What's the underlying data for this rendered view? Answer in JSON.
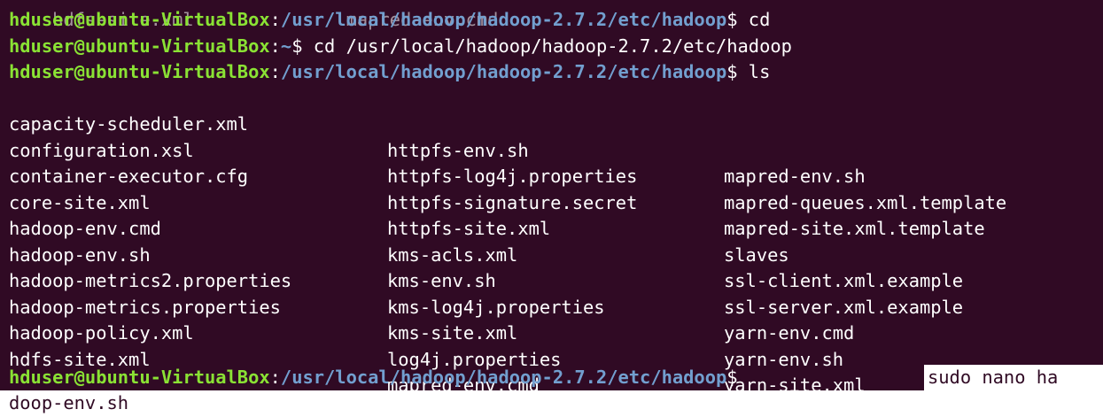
{
  "terminal": {
    "colors": {
      "background": "#300a24",
      "user": "#8ae234",
      "path": "#729fcf",
      "text": "#ffffff"
    },
    "partial_top_line": "hdfs-site.xml              mapred-env.cmd",
    "prompts": [
      {
        "user": "hduser@ubuntu-VirtualBox",
        "sep": ":",
        "path": "/usr/local/hadoop/hadoop-2.7.2/etc/hadoop",
        "end": "$",
        "command": " cd"
      },
      {
        "user": "hduser@ubuntu-VirtualBox",
        "sep": ":",
        "path": "~",
        "end": "$",
        "command": " cd /usr/local/hadoop/hadoop-2.7.2/etc/hadoop"
      },
      {
        "user": "hduser@ubuntu-VirtualBox",
        "sep": ":",
        "path": "/usr/local/hadoop/hadoop-2.7.2/etc/hadoop",
        "end": "$",
        "command": " ls"
      }
    ],
    "listing": [
      [
        "capacity-scheduler.xml",
        "httpfs-env.sh",
        "mapred-env.sh"
      ],
      [
        "configuration.xsl",
        "httpfs-log4j.properties",
        "mapred-queues.xml.template"
      ],
      [
        "container-executor.cfg",
        "httpfs-signature.secret",
        "mapred-site.xml.template"
      ],
      [
        "core-site.xml",
        "httpfs-site.xml",
        "slaves"
      ],
      [
        "hadoop-env.cmd",
        "kms-acls.xml",
        "ssl-client.xml.example"
      ],
      [
        "hadoop-env.sh",
        "kms-env.sh",
        "ssl-server.xml.example"
      ],
      [
        "hadoop-metrics2.properties",
        "kms-log4j.properties",
        "yarn-env.cmd"
      ],
      [
        "hadoop-metrics.properties",
        "kms-site.xml",
        "yarn-env.sh"
      ],
      [
        "hadoop-policy.xml",
        "log4j.properties",
        "yarn-site.xml"
      ],
      [
        "hdfs-site.xml",
        "mapred-env.cmd",
        ""
      ]
    ],
    "last_prompt": {
      "user": "hduser@ubuntu-VirtualBox",
      "sep": ":",
      "path": "/usr/local/hadoop/hadoop-2.7.2/etc/hadoop",
      "end": "$",
      "command_selected": "sudo nano ha",
      "command_wrapped": "doop-env.sh"
    }
  }
}
